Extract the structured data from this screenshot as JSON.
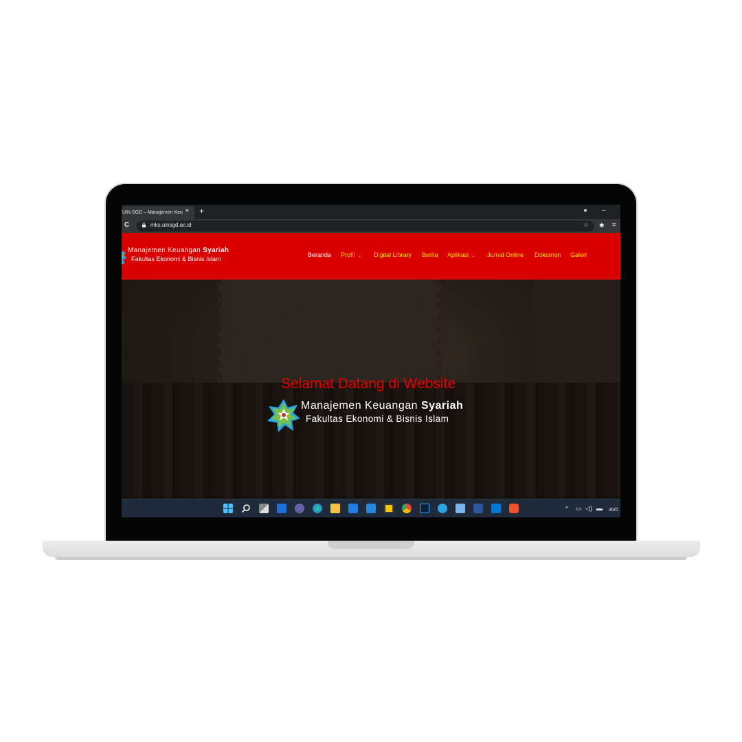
{
  "browser": {
    "tab_title": "UIN SGD – Manajemen Keu",
    "tab_close": "✕",
    "new_tab": "+",
    "url": "mks.uinsgd.ac.id"
  },
  "site": {
    "logo_line1_normal": "Manajemen Keuangan ",
    "logo_line1_bold": "Syariah",
    "logo_line2": "Fakultas Ekonomi & Bisnis Islam",
    "nav": [
      {
        "label": "Beranda",
        "dropdown": false
      },
      {
        "label": "Profil",
        "dropdown": true
      },
      {
        "label": "Digital Library",
        "dropdown": false
      },
      {
        "label": "Berita",
        "dropdown": false
      },
      {
        "label": "Aplikasi",
        "dropdown": true
      },
      {
        "label": "Jurnal Online",
        "dropdown": false
      },
      {
        "label": "Dokumen",
        "dropdown": false
      },
      {
        "label": "Galeri",
        "dropdown": false
      }
    ],
    "nav_caret": "⌄",
    "colors": {
      "header": "#d90000",
      "nav_text": "#ffe000",
      "nav_active": "#ffffff",
      "hero_title": "#e60000"
    }
  },
  "hero": {
    "title": "Selamat Datang di Website",
    "logo_line1_normal": "Manajemen Keuangan ",
    "logo_line1_bold": "Syariah",
    "logo_line2": "Fakultas Ekonomi & Bisnis Islam"
  },
  "taskbar": {
    "apps": [
      "start-icon",
      "search-icon",
      "task-view-icon",
      "widgets-icon",
      "chat-icon",
      "edge-icon",
      "file-explorer-icon",
      "store-icon",
      "mail-icon",
      "sticky-notes-icon",
      "chrome-icon",
      "photoshop-icon",
      "telegram-icon",
      "notepad-icon",
      "word-icon",
      "vscode-icon",
      "git-icon"
    ],
    "tray_chevron": "^",
    "time": "30/0"
  }
}
